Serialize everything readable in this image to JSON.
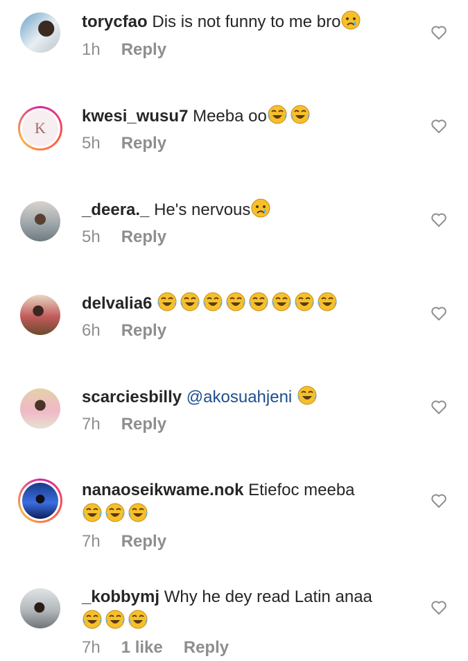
{
  "comments": [
    {
      "username": "torycfao",
      "text": "Dis is not funny to me bro",
      "emojis": [
        "sad-tear-emoji"
      ],
      "time": "1h",
      "reply_label": "Reply",
      "avatar_ring": false
    },
    {
      "username": "kwesi_wusu7",
      "text": "Meeba oo",
      "emojis": [
        "tears-of-joy-emoji",
        "tears-of-joy-emoji"
      ],
      "time": "5h",
      "reply_label": "Reply",
      "avatar_ring": true,
      "avatar_letter": "K"
    },
    {
      "username": "_deera._",
      "text": "He's nervous",
      "emojis": [
        "sad-tear-emoji"
      ],
      "time": "5h",
      "reply_label": "Reply",
      "avatar_ring": false
    },
    {
      "username": "delvalia6",
      "text": "",
      "emojis": [
        "tears-of-joy-emoji",
        "tears-of-joy-emoji",
        "tears-of-joy-emoji",
        "tears-of-joy-emoji",
        "tears-of-joy-emoji",
        "tears-of-joy-emoji",
        "tears-of-joy-emoji",
        "tears-of-joy-emoji"
      ],
      "time": "6h",
      "reply_label": "Reply",
      "avatar_ring": false
    },
    {
      "username": "scarciesbilly",
      "mention": "@akosuahjeni",
      "text": "",
      "emojis": [
        "tears-of-joy-emoji"
      ],
      "time": "7h",
      "reply_label": "Reply",
      "avatar_ring": false
    },
    {
      "username": "nanaoseikwame.nok",
      "text": "Etiefoc meeba",
      "emojis": [
        "tears-of-joy-emoji",
        "tears-of-joy-emoji",
        "tears-of-joy-emoji"
      ],
      "time": "7h",
      "reply_label": "Reply",
      "avatar_ring": true
    },
    {
      "username": "_kobbymj",
      "text": "Why he dey read Latin anaa",
      "emojis": [
        "tears-of-joy-emoji",
        "tears-of-joy-emoji",
        "tears-of-joy-emoji"
      ],
      "time": "7h",
      "likes": "1 like",
      "reply_label": "Reply",
      "avatar_ring": false
    }
  ],
  "colors": {
    "text": "#262626",
    "meta": "#8e8e8e",
    "mention": "#1d4f8c",
    "emoji_face": "#f6c02b"
  }
}
